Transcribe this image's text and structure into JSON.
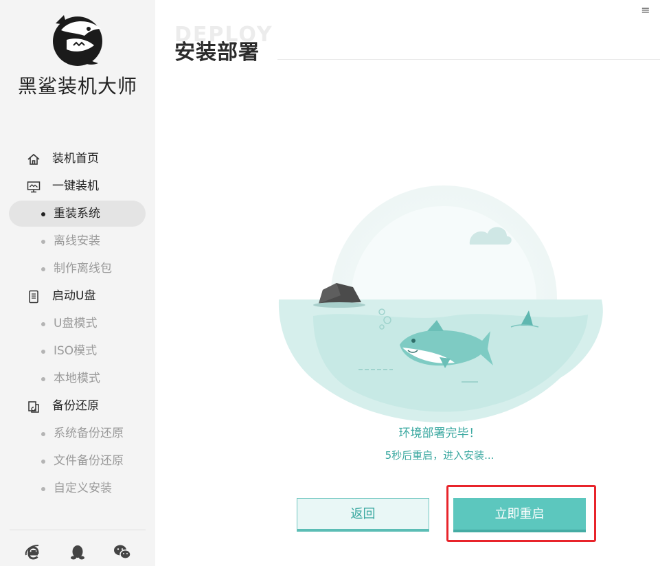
{
  "sidebar": {
    "brand": "黑鲨装机大师",
    "nav": [
      {
        "label": "装机首页",
        "icon": "home-icon"
      },
      {
        "label": "一键装机",
        "icon": "monitor-icon"
      },
      {
        "label": "重装系统",
        "active": true
      },
      {
        "label": "离线安装"
      },
      {
        "label": "制作离线包"
      },
      {
        "label": "启动U盘",
        "icon": "usb-drive-icon"
      },
      {
        "label": "U盘模式"
      },
      {
        "label": "ISO模式"
      },
      {
        "label": "本地模式"
      },
      {
        "label": "备份还原",
        "icon": "backup-restore-icon"
      },
      {
        "label": "系统备份还原"
      },
      {
        "label": "文件备份还原"
      },
      {
        "label": "自定义安装"
      }
    ],
    "bottom_icons": [
      "ie-browser-icon",
      "qq-penguin-icon",
      "wechat-icon"
    ]
  },
  "header": {
    "menu_icon": "≡",
    "bg_word": "DEPLOY",
    "title": "安装部署"
  },
  "main": {
    "status": "环境部署完毕！",
    "countdown": "5秒后重启，进入安装...",
    "back_label": "返回",
    "restart_label": "立即重启"
  },
  "colors": {
    "accent": "#5cc7be",
    "accent_text": "#3aa8a0",
    "highlight": "#e8242b",
    "sidebar_bg": "#f4f4f4"
  }
}
